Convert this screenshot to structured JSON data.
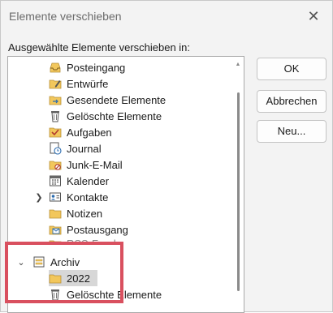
{
  "dialog": {
    "title": "Elemente verschieben",
    "prompt": "Ausgewählte Elemente verschieben in:"
  },
  "buttons": {
    "ok": "OK",
    "cancel": "Abbrechen",
    "new": "Neu..."
  },
  "folders": [
    {
      "label": "Posteingang",
      "icon": "inbox-icon"
    },
    {
      "label": "Entwürfe",
      "icon": "drafts-icon"
    },
    {
      "label": "Gesendete Elemente",
      "icon": "sent-items-icon"
    },
    {
      "label": "Gelöschte Elemente",
      "icon": "trash-icon"
    },
    {
      "label": "Aufgaben",
      "icon": "tasks-icon"
    },
    {
      "label": "Journal",
      "icon": "journal-icon"
    },
    {
      "label": "Junk-E-Mail",
      "icon": "junk-mail-icon"
    },
    {
      "label": "Kalender",
      "icon": "calendar-icon"
    },
    {
      "label": "Kontakte",
      "icon": "contacts-icon"
    },
    {
      "label": "Notizen",
      "icon": "notes-icon"
    },
    {
      "label": "Postausgang",
      "icon": "outbox-icon"
    },
    {
      "label": "RSS-Feeds",
      "icon": "rss-folder-icon"
    }
  ],
  "archive": {
    "label": "Archiv",
    "icon": "archive-icon",
    "children": [
      {
        "label": "2022",
        "icon": "folder-icon",
        "selected": true
      },
      {
        "label": "Gelöschte Elemente",
        "icon": "trash-icon"
      }
    ]
  },
  "colors": {
    "highlight_border": "#d9505f",
    "selection": "#d7d7d7",
    "folder": "#f2c75c"
  }
}
